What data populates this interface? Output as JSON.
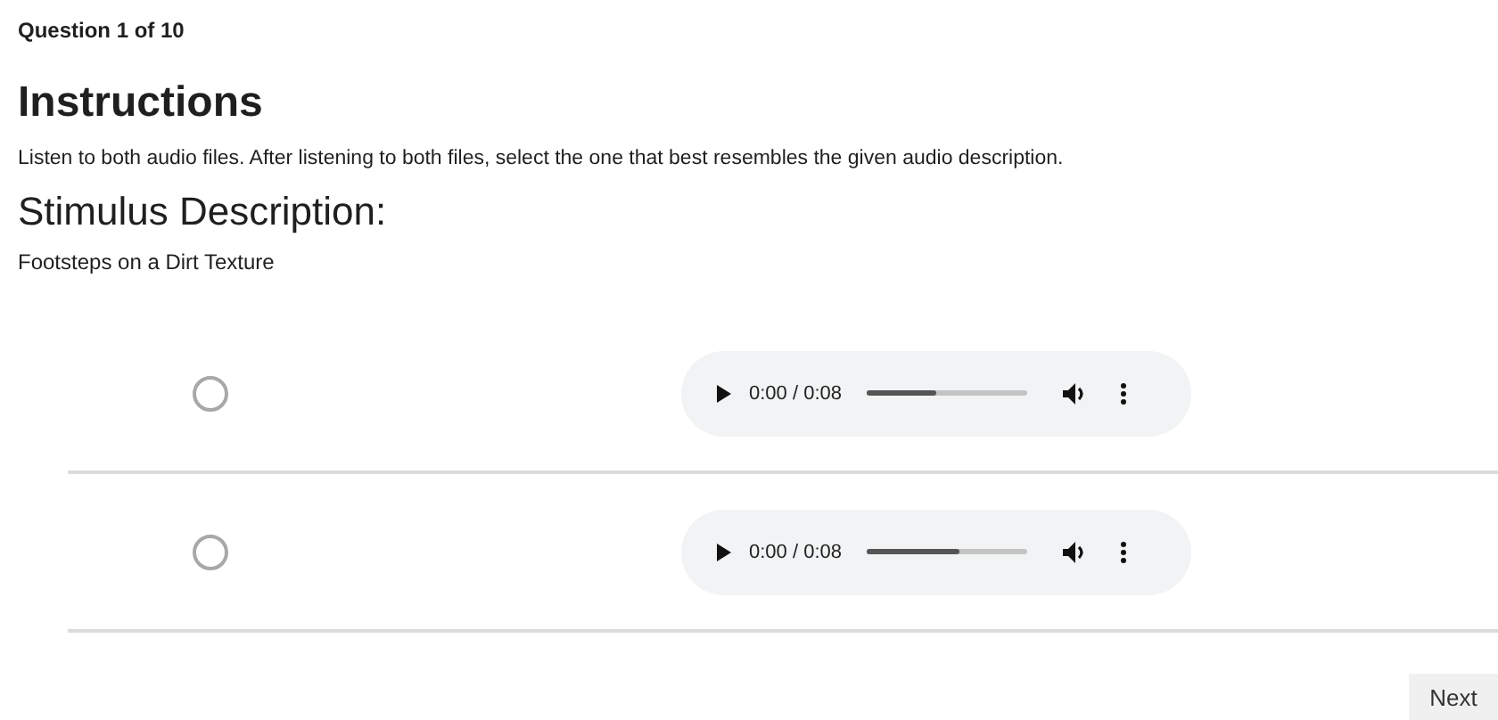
{
  "progress": "Question 1 of 10",
  "title": "Instructions",
  "instructions": "Listen to both audio files. After listening to both files, select the one that best resembles the given audio description.",
  "stimulus_heading": "Stimulus Description:",
  "stimulus": "Footsteps on a Dirt Texture",
  "options": [
    {
      "selected": false,
      "audio": {
        "time": "0:00 / 0:08",
        "level": 0.43
      }
    },
    {
      "selected": false,
      "audio": {
        "time": "0:00 / 0:08",
        "level": 0.58
      }
    }
  ],
  "next_button": "Next"
}
